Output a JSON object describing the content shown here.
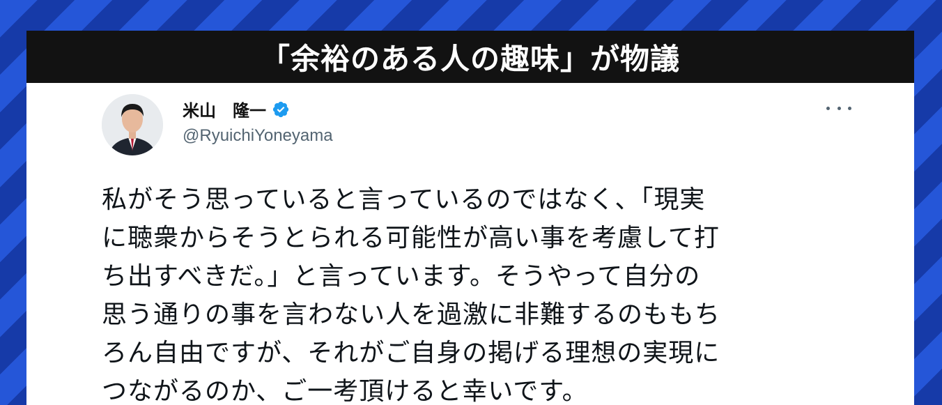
{
  "banner": {
    "title": "「余裕のある人の趣味」が物議"
  },
  "tweet": {
    "author": {
      "display_name": "米山　隆一",
      "handle": "@RyuichiYoneyama",
      "verified_icon": "verified-badge-icon",
      "avatar_icon": "profile-avatar"
    },
    "more_icon": "more-options-icon",
    "body_lines": [
      "私がそう思っていると言っているのではなく、「現実",
      "に聴衆からそうとられる可能性が高い事を考慮して打",
      "ち出すべきだ。」と言っています。そうやって自分の",
      "思う通りの事を言わない人を過激に非難するのももち",
      "ろん自由ですが、それがご自身の掲げる理想の実現に",
      "つながるのか、ご一考頂けると幸いです。"
    ]
  },
  "colors": {
    "background_blue": "#1d47c4",
    "banner_black": "#121212",
    "verified_blue": "#1d9bf0",
    "text": "#0f1419",
    "secondary_text": "#536471"
  }
}
